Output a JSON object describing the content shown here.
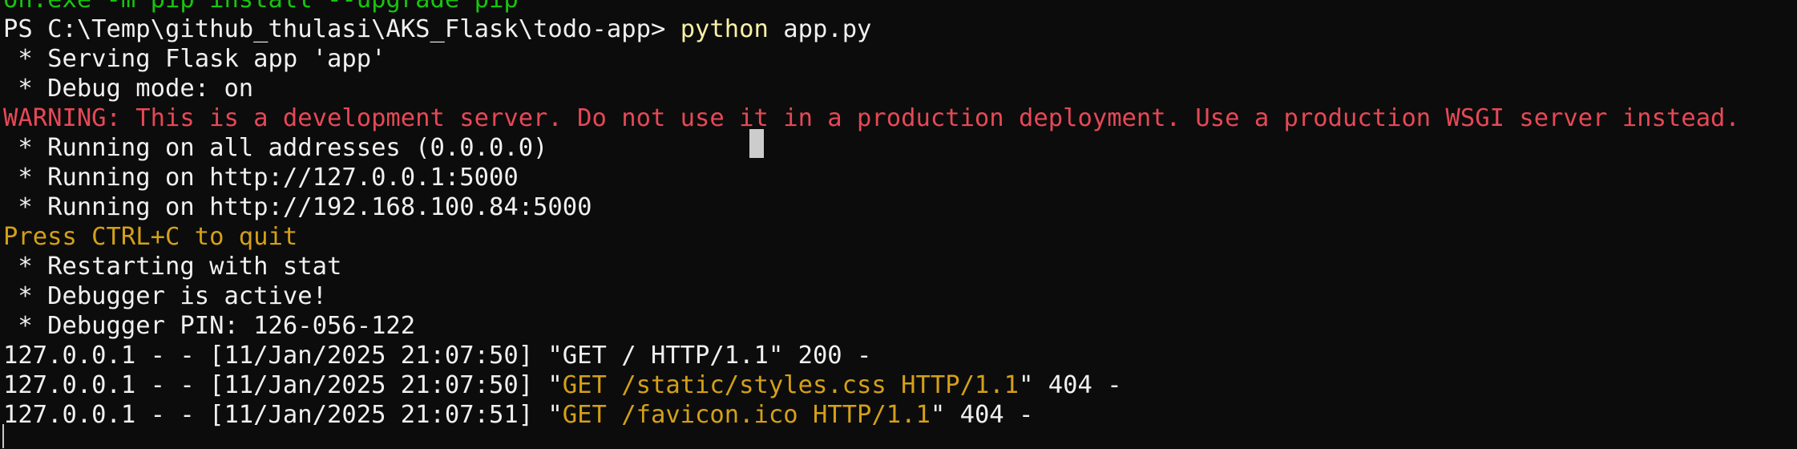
{
  "colors": {
    "background": "#0c0c0c",
    "foreground": "#f0f0f0",
    "command_green": "#16c60c",
    "warning_red": "#e74856",
    "highlight_yellow": "#d4a017",
    "command_yellow": "#f9f1a5"
  },
  "terminal": {
    "top_partial": "on.exe -m pip install --upgrade pip",
    "prompt": "PS C:\\Temp\\github_thulasi\\AKS_Flask\\todo-app> ",
    "command": "python",
    "command_args": " app.py",
    "serving": " * Serving Flask app 'app'",
    "debug_mode": " * Debug mode: on",
    "warning": "WARNING: This is a development server. Do not use it in a production deployment. Use a production WSGI server instead.",
    "running_all": " * Running on all addresses (0.0.0.0)",
    "running_local": " * Running on http://127.0.0.1:5000",
    "running_lan": " * Running on http://192.168.100.84:5000",
    "quit_hint": "Press CTRL+C to quit",
    "restarting": " * Restarting with stat",
    "debugger_active": " * Debugger is active!",
    "debugger_pin": " * Debugger PIN: 126-056-122",
    "requests": [
      {
        "prefix": "127.0.0.1 - - [11/Jan/2025 21:07:50] \"",
        "request": "GET / HTTP/1.1",
        "suffix": "\" 200 -"
      },
      {
        "prefix": "127.0.0.1 - - [11/Jan/2025 21:07:50] \"",
        "request": "GET /static/styles.css HTTP/1.1",
        "suffix": "\" 404 -"
      },
      {
        "prefix": "127.0.0.1 - - [11/Jan/2025 21:07:51] \"",
        "request": "GET /favicon.ico HTTP/1.1",
        "suffix": "\" 404 -"
      }
    ]
  }
}
